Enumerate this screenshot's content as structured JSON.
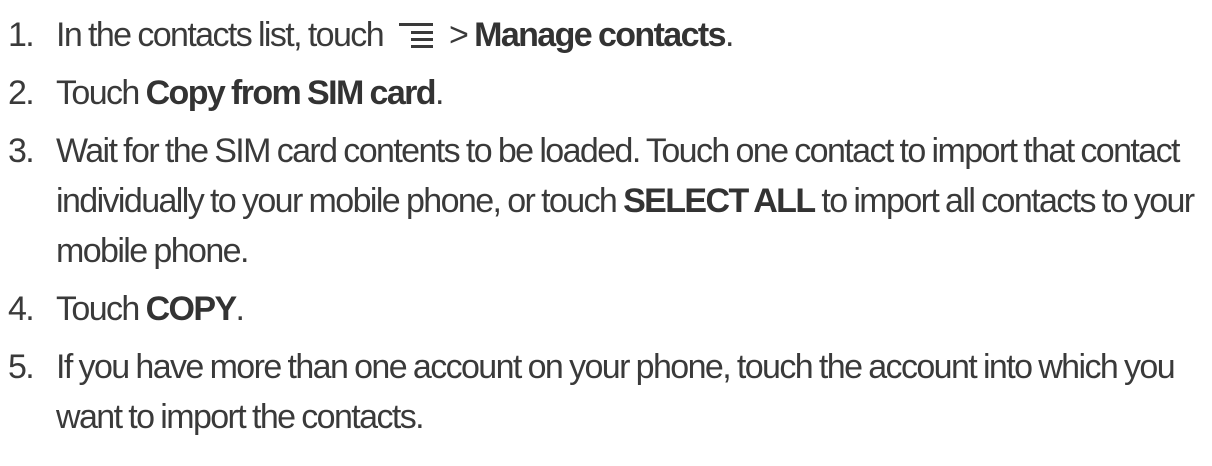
{
  "steps": [
    {
      "num": "1.",
      "text1": "In the contacts list, touch",
      "icon": "menu-icon",
      "text2": "> ",
      "bold": "Manage contacts",
      "text3": "."
    },
    {
      "num": "2.",
      "text1": "Touch ",
      "bold": "Copy from SIM card",
      "text2": "."
    },
    {
      "num": "3.",
      "text1": "Wait for the SIM card contents to be loaded. Touch one contact to import that contact individually to your mobile phone, or touch ",
      "bold": "SELECT ALL",
      "text2": " to import all contacts to your mobile phone."
    },
    {
      "num": "4.",
      "text1": "Touch ",
      "bold": "COPY",
      "text2": "."
    },
    {
      "num": "5.",
      "text1": "If you have more than one account on your phone, touch the account into which you want to import the contacts."
    }
  ]
}
